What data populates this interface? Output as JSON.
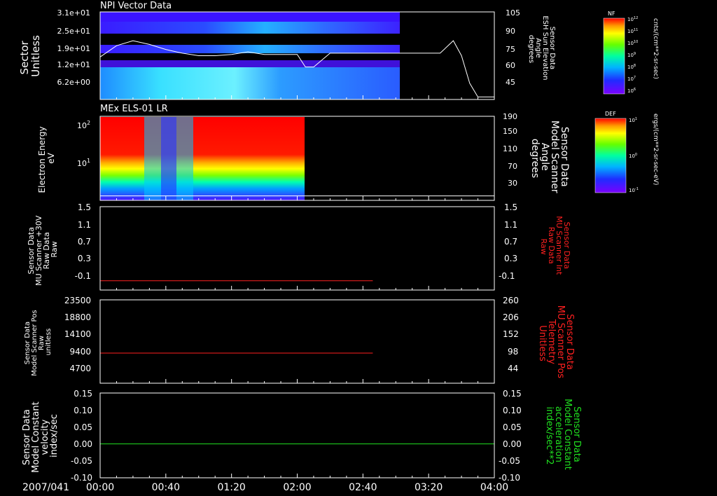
{
  "date_label": "2007/041",
  "time_ticks": [
    "00:00",
    "00:40",
    "01:20",
    "02:00",
    "02:40",
    "03:20",
    "04:00"
  ],
  "colors": {
    "red_line": "#ff2020",
    "green_line": "#20e020",
    "red_text": "#ff2020",
    "green_text": "#20e020",
    "white": "#ffffff"
  },
  "panels": [
    {
      "title": "NPI Vector Data",
      "left_label_lines": [
        "Sector",
        "Unitless"
      ],
      "left_ticks": [
        "3.1e+01",
        "2.5e+01",
        "1.9e+01",
        "1.2e+01",
        "6.2e+00"
      ],
      "right_label_lines": [
        "Sensor Data",
        "ESH Sun Elevation",
        "Angle",
        "degrees"
      ],
      "right_ticks": [
        "105",
        "90",
        "75",
        "60",
        "45"
      ]
    },
    {
      "title": "MEx ELS-01 LR",
      "left_label_lines": [
        "Electron Energy",
        "eV"
      ],
      "left_ticks": [
        "10",
        "10"
      ],
      "left_tick_exponents": [
        "2",
        "1"
      ],
      "right_label_lines": [
        "Sensor Data",
        "Model Scanner",
        "Angle",
        "degrees"
      ],
      "right_ticks": [
        "190",
        "150",
        "110",
        "70",
        "30"
      ]
    },
    {
      "title": "",
      "left_label_lines": [
        "Sensor Data",
        "MU Scanner +30V",
        "Raw Data",
        "Raw"
      ],
      "left_ticks": [
        "1.5",
        "1.1",
        "0.7",
        "0.3",
        "-0.1"
      ],
      "right_label_lines": [
        "Sensor Data",
        "MU Scanner Int",
        "Raw Data",
        "Raw"
      ],
      "right_ticks": [
        "1.5",
        "1.1",
        "0.7",
        "0.3",
        "-0.1"
      ]
    },
    {
      "title": "",
      "left_label_lines": [
        "Sensor Data",
        "Model Scanner Pos",
        "Raw",
        "unitless"
      ],
      "left_ticks": [
        "23500",
        "18800",
        "14100",
        "9400",
        "4700"
      ],
      "right_label_lines": [
        "Sensor Data",
        "MU Scanner Pos",
        "Telemetry",
        "Unitless"
      ],
      "right_ticks": [
        "260",
        "206",
        "152",
        "98",
        "44"
      ]
    },
    {
      "title": "",
      "left_label_lines": [
        "Sensor Data",
        "Model Constant",
        "velocity",
        "index/sec"
      ],
      "left_ticks": [
        "0.15",
        "0.10",
        "0.05",
        "0.00",
        "-0.05",
        "-0.10"
      ],
      "right_label_lines": [
        "Sensor Data",
        "Model Constant",
        "acceleration",
        "index/sec**2"
      ],
      "right_ticks": [
        "0.15",
        "0.10",
        "0.05",
        "0.00",
        "-0.05",
        "-0.10"
      ]
    }
  ],
  "colorbars": [
    {
      "label": "NF",
      "unit": "cnts/(cm**2-sr-sec)",
      "ticks": [
        "10",
        "10",
        "10",
        "10",
        "10",
        "10",
        "10"
      ],
      "tick_exponents": [
        "12",
        "11",
        "10",
        "9",
        "8",
        "7",
        "6"
      ]
    },
    {
      "label": "DEF",
      "unit": "ergs/(cm**2-sr-sec-eV)",
      "ticks": [
        "10",
        "10",
        "10"
      ],
      "tick_exponents": [
        "1",
        "0",
        "-1"
      ]
    }
  ],
  "chart_data": [
    {
      "type": "heatmap",
      "title": "NPI Vector Data",
      "ylabel": "Sector Unitless",
      "y2label": "Sensor Data ESH Sun Elevation Angle degrees",
      "xlim": [
        "00:00",
        "04:00"
      ],
      "data_end_time": "02:44",
      "sector_rows": [
        31,
        25,
        19,
        12,
        6.2
      ],
      "y2lim": [
        35,
        105
      ],
      "overlay_line": {
        "time_min": [
          0,
          10,
          20,
          30,
          40,
          50,
          60,
          70,
          80,
          85,
          90,
          100,
          110,
          120,
          125,
          130,
          140,
          150,
          160,
          170,
          180,
          190,
          200,
          207,
          215,
          220,
          225,
          230,
          240
        ],
        "values": [
          69,
          78,
          82,
          79,
          75,
          72,
          70,
          70,
          71,
          72,
          73,
          71,
          71,
          71,
          61,
          61,
          72,
          72,
          72,
          72,
          72,
          72,
          72,
          72,
          82,
          70,
          48,
          37,
          37
        ]
      }
    },
    {
      "type": "heatmap",
      "title": "MEx ELS-01 LR",
      "ylabel": "Electron Energy eV",
      "y2label": "Sensor Data Model Scanner Angle degrees",
      "xlim": [
        "00:00",
        "04:00"
      ],
      "data_end_time": "02:06",
      "yscale": "log",
      "y2lim": [
        0,
        190
      ],
      "overlay_line_value": 10
    },
    {
      "type": "line",
      "ylabel": "Sensor Data MU Scanner +30V Raw Data Raw",
      "y2label": "Sensor Data MU Scanner Int Raw Data Raw",
      "xlim": [
        "00:00",
        "04:00"
      ],
      "ylim": [
        -0.3,
        1.5
      ],
      "series": [
        {
          "x_end_time": "02:46",
          "value": -0.1
        }
      ]
    },
    {
      "type": "line",
      "ylabel": "Sensor Data Model Scanner Pos Raw unitless",
      "y2label": "Sensor Data MU Scanner Pos Telemetry Unitless",
      "xlim": [
        "00:00",
        "04:00"
      ],
      "ylim": [
        0,
        23500
      ],
      "series": [
        {
          "x_end_time": "02:46",
          "value": 8500
        }
      ]
    },
    {
      "type": "line",
      "ylabel": "Sensor Data Model Constant velocity index/sec",
      "y2label": "Sensor Data Model Constant acceleration index/sec**2",
      "xlim": [
        "00:00",
        "04:00"
      ],
      "ylim": [
        -0.1,
        0.15
      ],
      "series": [
        {
          "value": 0.0
        }
      ]
    }
  ]
}
